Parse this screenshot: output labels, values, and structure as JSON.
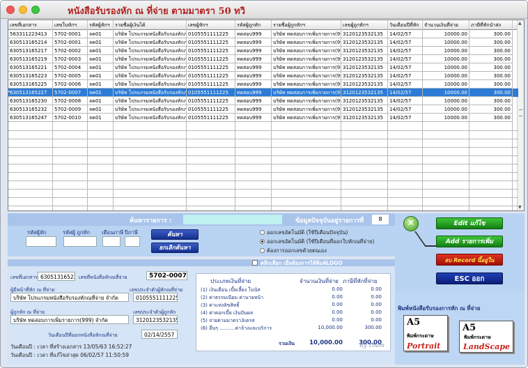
{
  "window": {
    "title": "หนังสือรับรองหัก ณ ที่จ่าย ตามมาตรา 50 ทวิ"
  },
  "grid": {
    "columns": [
      "เลขที่เอกสาร",
      "เลขใบหักฯ",
      "รหัสผู้หักฯ",
      "รายชื่อผู้เงินได้",
      "เลขผู้หักฯ",
      "รหัสผู้ถูกหัก",
      "รายชื่อผู้ถูกหักฯ",
      "เลขผู้ถูกหักฯ",
      "วันเดือนปีที่หัก",
      "จำนวนเงินที่จ่าย",
      "ภาษีที่หักนำส่ง"
    ],
    "rows": [
      [
        "563311223413",
        "5702-0001",
        "ลค01",
        "บริษัท โปรแกรมหนังสือรับรองหักภาษี",
        "0105551111225",
        "ทดสอบ999",
        "บริษัท ทดสอบการเพิ่มรายการ(999)",
        "3120123532135",
        "14/02/57",
        "10000.00",
        "300.00"
      ],
      [
        "630513165214",
        "5702-0001",
        "ลค01",
        "บริษัท โปรแกรมหนังสือรับรองหักภาษี",
        "0105551111225",
        "ทดสอบ999",
        "บริษัท ทดสอบการเพิ่มรายการ(999)",
        "3120123532135",
        "14/02/57",
        "10000.00",
        "300.00"
      ],
      [
        "630513165217",
        "5702-0002",
        "ลค01",
        "บริษัท โปรแกรมหนังสือรับรองหักภาษี",
        "0105551111225",
        "ทดสอบ999",
        "บริษัท ทดสอบการเพิ่มรายการ(999)",
        "3120123532135",
        "14/02/57",
        "10000.00",
        "300.00"
      ],
      [
        "630513165219",
        "5702-0003",
        "ลค01",
        "บริษัท โปรแกรมหนังสือรับรองหักภาษี",
        "0105551111225",
        "ทดสอบ999",
        "บริษัท ทดสอบการเพิ่มรายการ(999)",
        "3120123532135",
        "14/02/57",
        "10000.00",
        "300.00"
      ],
      [
        "630513165221",
        "5702-0004",
        "ลค01",
        "บริษัท โปรแกรมหนังสือรับรองหักภาษี",
        "0105551111225",
        "ทดสอบ999",
        "บริษัท ทดสอบการเพิ่มรายการ(999)",
        "3120123532135",
        "14/02/57",
        "10000.00",
        "300.00"
      ],
      [
        "630513165223",
        "5702-0005",
        "ลค01",
        "บริษัท โปรแกรมหนังสือรับรองหักภาษี",
        "0105551111225",
        "ทดสอบ999",
        "บริษัท ทดสอบการเพิ่มรายการ(999)",
        "3120123532135",
        "14/02/57",
        "10000.00",
        "300.00"
      ],
      [
        "630513165225",
        "5702-0006",
        "ลค01",
        "บริษัท โปรแกรมหนังสือรับรองหักภาษี",
        "0105551111225",
        "ทดสอบ999",
        "บริษัท ทดสอบการเพิ่มรายการ(999)",
        "3120123532135",
        "14/02/57",
        "10000.00",
        "300.00"
      ],
      [
        "630513165227",
        "5702-0007",
        "ลค01",
        "บริษัท โปรแกรมหนังสือรับรองหักภาษี",
        "0105551111225",
        "ทดสอบ999",
        "บริษัท ทดสอบการเพิ่มรายการ(999)",
        "3120123532135",
        "14/02/57",
        "10000.00",
        "300.00"
      ],
      [
        "630513165230",
        "5702-0008",
        "ลค01",
        "บริษัท โปรแกรมหนังสือรับรองหักภาษี",
        "0105551111225",
        "ทดสอบ999",
        "บริษัท ทดสอบการเพิ่มรายการ(999)",
        "3120123532135",
        "14/02/57",
        "10000.00",
        "300.00"
      ],
      [
        "630513165232",
        "5702-0009",
        "ลค01",
        "บริษัท โปรแกรมหนังสือรับรองหักภาษี",
        "0105551111225",
        "ทดสอบ999",
        "บริษัท ทดสอบการเพิ่มรายการ(999)",
        "3120123532135",
        "14/02/57",
        "10000.00",
        "300.00"
      ],
      [
        "630513165247",
        "5702-0010",
        "ลค01",
        "บริษัท โปรแกรมหนังสือรับรองหักภาษี",
        "0105551111225",
        "ทดสอบ999",
        "บริษัท ทดสอบการเพิ่มรายการ(999)",
        "3120123532135",
        "14/02/57",
        "10000.00",
        "300.00"
      ]
    ],
    "selected_row": 7
  },
  "search": {
    "label": "ค้นหารายการ :",
    "value": "",
    "rowcount_label": "ข้อมูลปัจจุบันอยู่รายการที่",
    "rowcount": "8"
  },
  "filter": {
    "labels": [
      "รหัสผู้หัก",
      "รหัสผู้ ถูกหัก",
      "เดือนภาษี",
      "ปีภาษี"
    ],
    "search_button": "ค้นหา",
    "cancel_button": "ยกเลิกค้นหา",
    "radios": [
      "ออกเลขอัตโนมัติ (ใช้ปีเดือนปัจจุบัน)",
      "ออกเลขอัตโนมัติ (ใช้ปีเดือนที่ออกใบหักณที่จ่าย)",
      "ต้องการออกเลขด้วยตนเอง"
    ],
    "selected_radio": 1
  },
  "actions": {
    "edit": "Edit แก้ไข",
    "add": "Add รายการเพิ่ม",
    "delete": "ลบ Record นี้อยู่ใน",
    "esc": "ESC ออก"
  },
  "detail": {
    "logo_checkbox_label": "คลิกเลือก เมื่อต้องการให้พิมพ์LOGO",
    "doc_no_label": "เลขที่เอกสาร",
    "doc_no": "630513165227",
    "cert_no_label": "เลขที่หนังสือหักณที่จ่าย",
    "cert_no": "5702-0007",
    "payer_label": "ผู้มีหน้าที่หัก ณ ที่จ่าย",
    "payer_tax_label": "เลขประจำตัวผู้หักณที่จ่าย",
    "payer": "บริษัท โปรแกรมหนังสือรับรองหักณที่จ่าย จำกัด",
    "payer_tax": "0105551111225",
    "payee_label": "ผู้ถูกหัก ณ ที่จ่าย",
    "payee_tax_label": "เลขประจำตัวผู้ถูกหัก",
    "payee": "บริษัท ทดสอบการเพิ่มรายการ(999) จำกัด",
    "payee_tax": "3120123532135",
    "issue_date_label": "วันเดือนปีที่ออกหนังสือหักณที่จ่าย",
    "issue_date": "02/14/2557",
    "created": "วันเดือนปี : เวลา ที่สร้างเอกสาร 13/05/63 16:52:27",
    "modified": "วันเดือนปี : เวลา ที่แก้ไขล่าสุด 06/02/57 11:50:59"
  },
  "income": {
    "col_type": "ประเภทเงินที่จ่าย",
    "col_amount": "จำนวนเงินที่จ่าย",
    "col_tax": "ภาษีที่หักที่จ่าย",
    "items": [
      {
        "label": "(1) เงินเดือน เบี้ยเลี้ยง โบนัส",
        "amount": "0.00",
        "tax": "0.00"
      },
      {
        "label": "(2) ค่าธรรมเนียม ค่านายหน้า",
        "amount": "0.00",
        "tax": "0.00"
      },
      {
        "label": "(3) ค่าแห่งลิขสิทธิ์",
        "amount": "0.00",
        "tax": "0.00"
      },
      {
        "label": "(4) ค่าดอกเบี้ย เงินปันผล",
        "amount": "0.00",
        "tax": "0.00"
      },
      {
        "label": "(5) จ่ายตามมาตรา3เตรส",
        "amount": "0.00",
        "tax": "0.00"
      },
      {
        "label": "(6) อื่นๆ ..........ค่าจ้างและบริการ",
        "amount": "10,000.00",
        "tax": "300.00"
      }
    ],
    "total_label": "รวมเงิน",
    "total_amount": "10,000.00",
    "total_tax": "300.00",
    "signature": "By Tham"
  },
  "print": {
    "title": "พิมพ์หนังสือรับรองการหัก ณ ที่จ่าย",
    "paper_size": "A5",
    "paper_text": "พิมพ์กระดาษ",
    "portrait": "Portrait",
    "landscape": "LandScape"
  }
}
